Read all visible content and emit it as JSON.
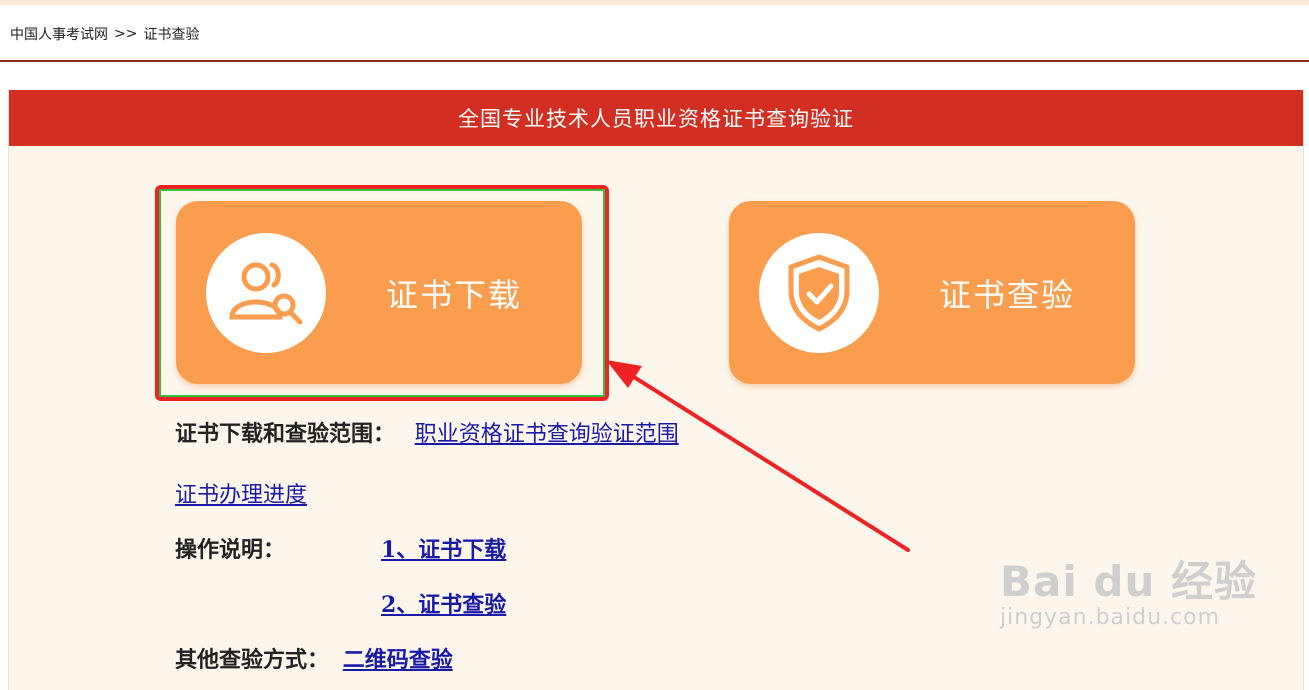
{
  "breadcrumb": {
    "home": "中国人事考试网",
    "separator": ">>",
    "current": "证书查验"
  },
  "panel": {
    "title": "全国专业技术人员职业资格证书查询验证"
  },
  "tiles": {
    "download": {
      "label": "证书下载",
      "icon": "user-search-icon"
    },
    "verify": {
      "label": "证书查验",
      "icon": "shield-check-icon"
    }
  },
  "info": {
    "scope_label": "证书下载和查验范围：",
    "scope_link": "职业资格证书查询验证范围",
    "progress_link": "证书办理进度",
    "instructions_label": "操作说明：",
    "instruction_1": "1、证书下载",
    "instruction_2": "2、证书查验",
    "other_label": "其他查验方式：",
    "qr_link": "二维码查验"
  },
  "watermark": {
    "logo": "Bai du 经验",
    "url": "jingyan.baidu.com"
  },
  "colors": {
    "header_red": "#d22e22",
    "tile_orange": "#fb9d4f",
    "link_blue": "#1a1aa8",
    "annotation_red": "#ee2222"
  }
}
